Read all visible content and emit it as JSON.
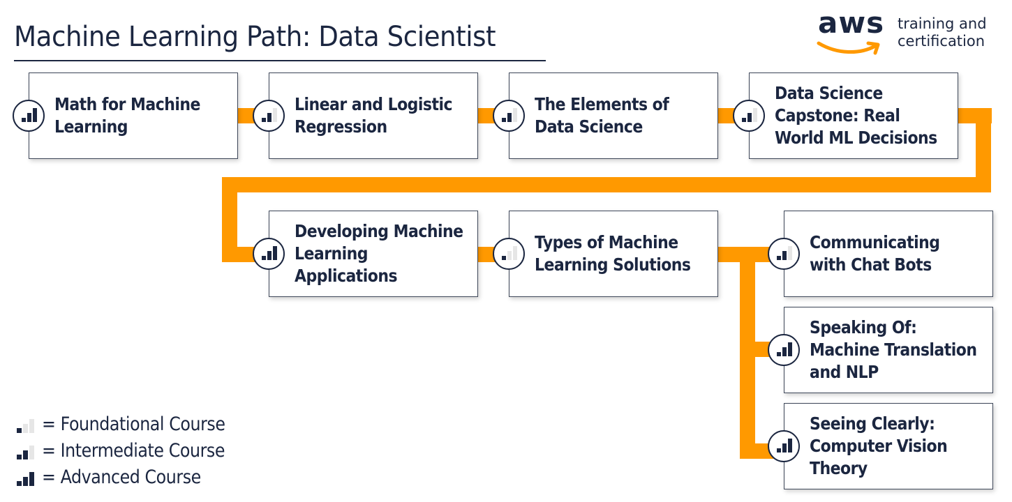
{
  "header": {
    "title": "Machine Learning Path: Data Scientist",
    "logo": {
      "wordmark": "aws",
      "line1": "training and",
      "line2": "certification"
    }
  },
  "colors": {
    "accent": "#ff9900",
    "text": "#1b2640",
    "inactive_bar": "#e6e6e6"
  },
  "courses": [
    {
      "title_lines": [
        "Math for Machine",
        "Learning"
      ],
      "level": "Advanced",
      "level_bars": 3
    },
    {
      "title_lines": [
        "Linear and Logistic",
        "Regression"
      ],
      "level": "Intermediate",
      "level_bars": 2
    },
    {
      "title_lines": [
        "The Elements of",
        "Data Science"
      ],
      "level": "Intermediate",
      "level_bars": 2
    },
    {
      "title_lines": [
        "Data Science",
        "Capstone: Real",
        "World ML Decisions"
      ],
      "level": "Intermediate",
      "level_bars": 2
    },
    {
      "title_lines": [
        "Developing Machine",
        "Learning",
        "Applications"
      ],
      "level": "Advanced",
      "level_bars": 3
    },
    {
      "title_lines": [
        "Types of Machine",
        "Learning Solutions"
      ],
      "level": "Foundational",
      "level_bars": 1
    },
    {
      "title_lines": [
        "Communicating",
        "with Chat Bots"
      ],
      "level": "Intermediate",
      "level_bars": 2
    },
    {
      "title_lines": [
        "Speaking Of:",
        "Machine Translation",
        "and NLP"
      ],
      "level": "Advanced",
      "level_bars": 3
    },
    {
      "title_lines": [
        "Seeing Clearly:",
        "Computer Vision",
        "Theory"
      ],
      "level": "Advanced",
      "level_bars": 3
    }
  ],
  "legend": [
    {
      "level_bars": 1,
      "label": "= Foundational Course"
    },
    {
      "level_bars": 2,
      "label": "= Intermediate Course"
    },
    {
      "level_bars": 3,
      "label": "= Advanced Course"
    }
  ]
}
